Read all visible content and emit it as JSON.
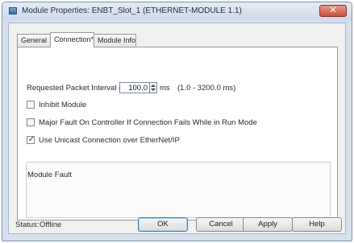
{
  "window": {
    "title": "Module Properties: ENBT_Slot_1 (ETHERNET-MODULE 1.1)",
    "close_symbol": "✕"
  },
  "tabs": [
    {
      "label": "General",
      "active": false
    },
    {
      "label": "Connection*",
      "active": true
    },
    {
      "label": "Module Info",
      "active": false
    }
  ],
  "connection": {
    "rpi_label": "Requested Packet Interval (RPI):",
    "rpi_value": "100.0",
    "rpi_unit": "ms",
    "rpi_range": "(1.0 - 3200.0 ms)",
    "inhibit_label": "Inhibit Module",
    "inhibit_checked": false,
    "major_fault_label": "Major Fault On Controller If Connection Fails While in Run Mode",
    "major_fault_checked": false,
    "unicast_label": "Use Unicast Connection over EtherNet/IP",
    "unicast_checked": true,
    "check_symbol": "✓",
    "module_fault_label": "Module Fault"
  },
  "status": {
    "label": "Status:",
    "value": "Offline"
  },
  "buttons": {
    "ok": "OK",
    "cancel": "Cancel",
    "apply": "Apply",
    "help": "Help"
  },
  "colors": {
    "title_bar": "#cdd9e8",
    "close_button": "#c9523f",
    "dialog_background": "#f0f0f0"
  }
}
